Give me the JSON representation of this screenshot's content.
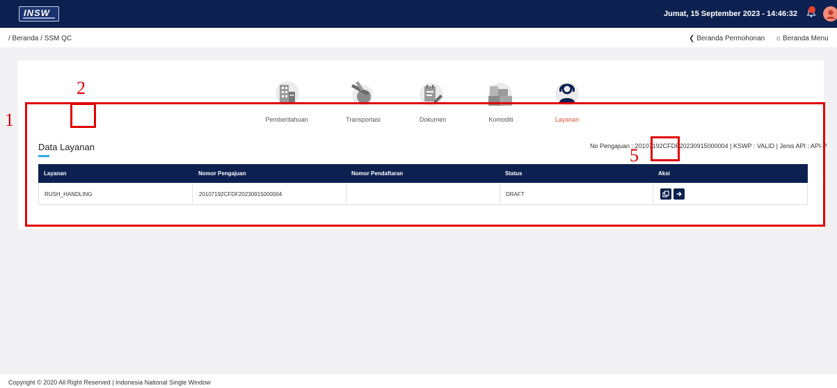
{
  "header": {
    "logo_text": "INSW",
    "datetime": "Jumat, 15 September 2023 - 14:46:32"
  },
  "subbar": {
    "breadcrumb": "/ Beranda / SSM QC",
    "link_permohonan": "Beranda Permohonan",
    "link_menu": "Beranda Menu"
  },
  "steps": [
    {
      "label": "Pemberitahuan"
    },
    {
      "label": "Transportasi"
    },
    {
      "label": "Dokumen"
    },
    {
      "label": "Komoditi"
    },
    {
      "label": "Layanan"
    }
  ],
  "section": {
    "title": "Data Layanan",
    "meta": "No Pengajuan : 20107192CFDF20230915000004 | KSWP : VALID | Jenis API : API-P"
  },
  "table": {
    "headers": [
      "Layanan",
      "Nomor Pengajuan",
      "Nomor Pendaftaran",
      "Status",
      "Aksi"
    ],
    "rows": [
      {
        "layanan": "RUSH_HANDLING",
        "nomor_pengajuan": "20107192CFDF20230915000004",
        "nomor_pendaftaran": "",
        "status": "DRAFT"
      }
    ]
  },
  "annotations": {
    "n1": "1",
    "n2": "2",
    "n5": "5"
  },
  "colors": {
    "navy": "#0d2150",
    "active_step": "#e5533e",
    "annotation": "#e00000"
  },
  "footer": {
    "text": "Copyright © 2020 All Right Reserved | Indonesia National Single Window"
  }
}
